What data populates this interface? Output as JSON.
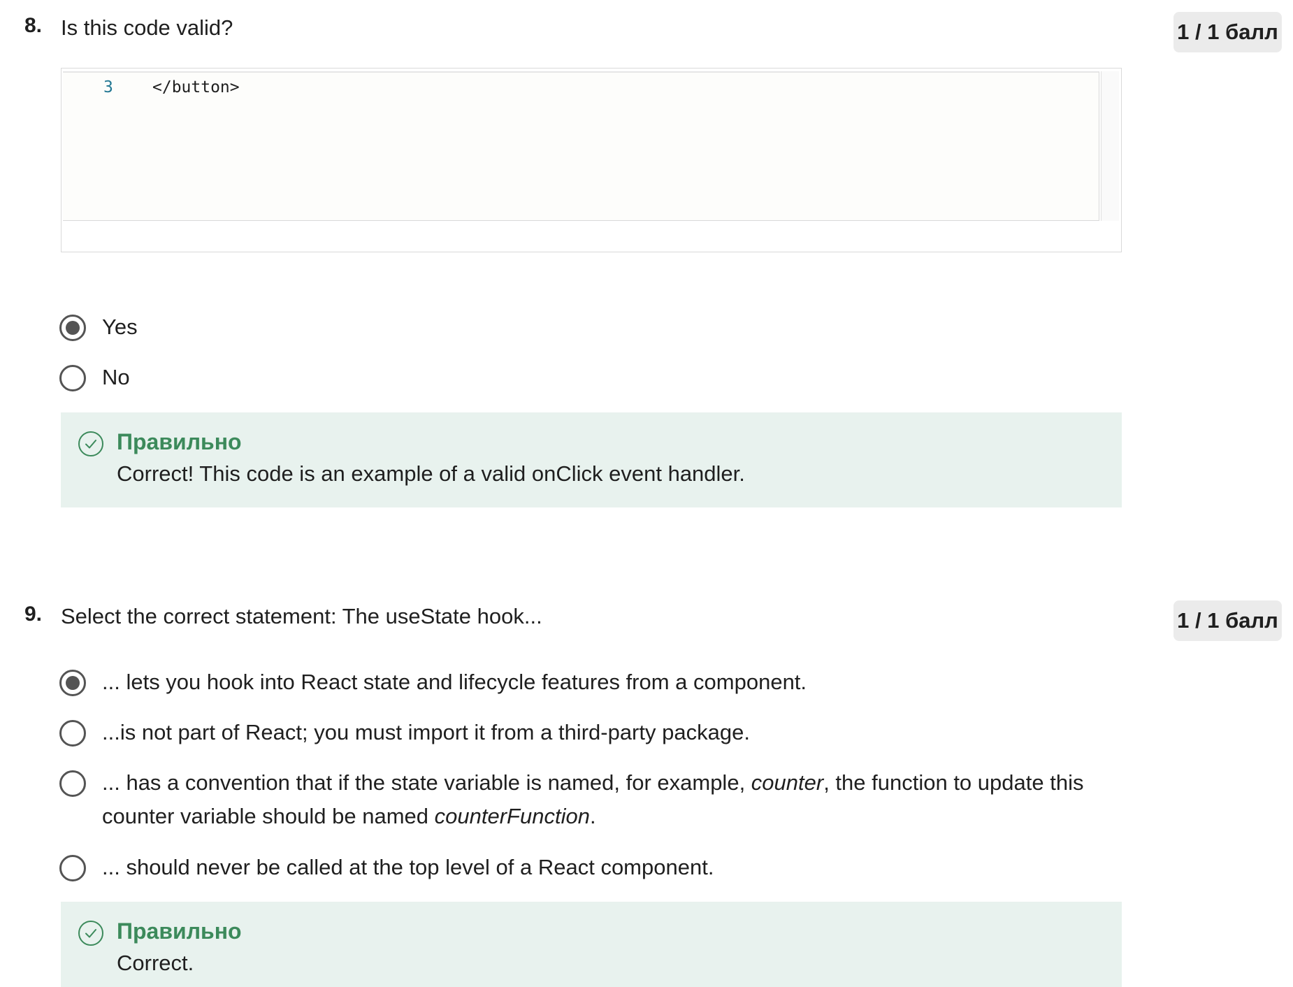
{
  "questions": [
    {
      "number": "8.",
      "text": "Is this code valid?",
      "score": "1 / 1 балл",
      "code": {
        "line_number": "3",
        "line_text": "</button>"
      },
      "options": [
        {
          "label": "Yes",
          "selected": true
        },
        {
          "label": "No",
          "selected": false
        }
      ],
      "feedback": {
        "title": "Правильно",
        "text": "Correct! This code is an example of a valid onClick event handler."
      }
    },
    {
      "number": "9.",
      "text": "Select the correct statement: The useState hook...",
      "score": "1 / 1 балл",
      "options": [
        {
          "label": "... lets you hook into React state and lifecycle features from a component.",
          "selected": true
        },
        {
          "label": "...is not  part of React; you must import it from a third-party package.",
          "selected": false
        },
        {
          "label_part1": "... has a convention that if the state variable is named, for example, ",
          "label_em1": "counter",
          "label_part2": ", the function to update this counter variable should be named ",
          "label_em2": "counterFunction",
          "label_part3": ".",
          "selected": false
        },
        {
          "label": "... should never be called at the top level of a React component.",
          "selected": false
        }
      ],
      "feedback": {
        "title": "Правильно",
        "text": "Correct."
      }
    }
  ],
  "colors": {
    "feedback_bg": "#e8f2ee",
    "feedback_title": "#3c8a5b",
    "badge_bg": "#ebebeb",
    "radio": "#545454",
    "line_number": "#237893"
  },
  "icons": {
    "feedback": "check-circle-icon"
  }
}
